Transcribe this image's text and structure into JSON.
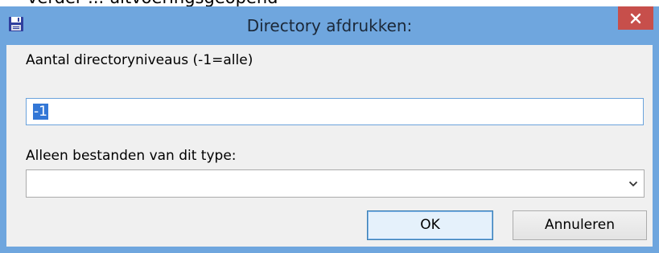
{
  "window": {
    "title": "Directory afdrukken:",
    "background_partial_text": "verder ... uitvoeringsgeopend",
    "accent_color": "#6fa6de",
    "close_button_color": "#c74f4b"
  },
  "icons": {
    "app": "floppy-disk-icon",
    "close": "close-icon",
    "dropdown": "chevron-down-icon"
  },
  "form": {
    "levels_label": "Aantal directoryniveaus (-1=alle)",
    "levels_value": "-1",
    "type_label": "Alleen bestanden van dit type:",
    "type_value": ""
  },
  "buttons": {
    "ok": "OK",
    "cancel": "Annuleren"
  }
}
